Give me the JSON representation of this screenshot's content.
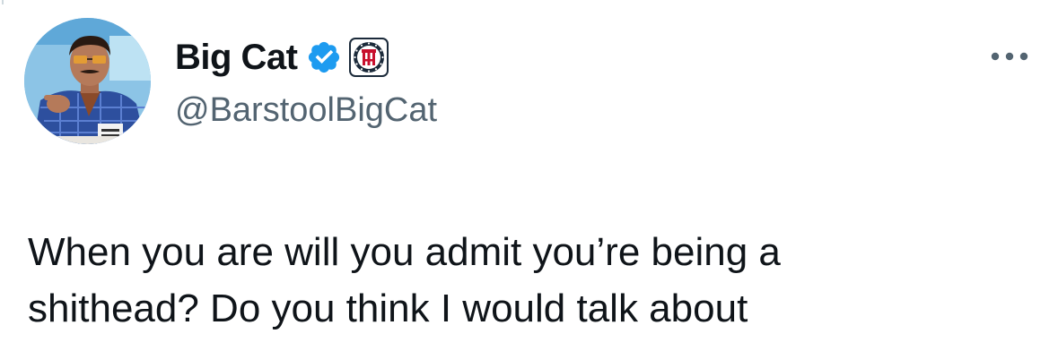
{
  "author": {
    "display_name": "Big Cat",
    "handle": "@BarstoolBigCat",
    "avatar_description": "profile photo",
    "verified": true,
    "affiliate_badge": "barstool-stool-logo"
  },
  "tweet": {
    "text": "When you are will you admit you’re being a\nshithead? Do you think I would talk about"
  },
  "icons": {
    "verified": "verified-badge-icon",
    "affiliate": "barstool-badge-icon",
    "more": "more-options-icon"
  },
  "colors": {
    "text_primary": "#0f1419",
    "text_secondary": "#536471",
    "verified_blue": "#1d9bf0",
    "badge_dark": "#1b2a3a",
    "badge_red": "#c8102e"
  }
}
